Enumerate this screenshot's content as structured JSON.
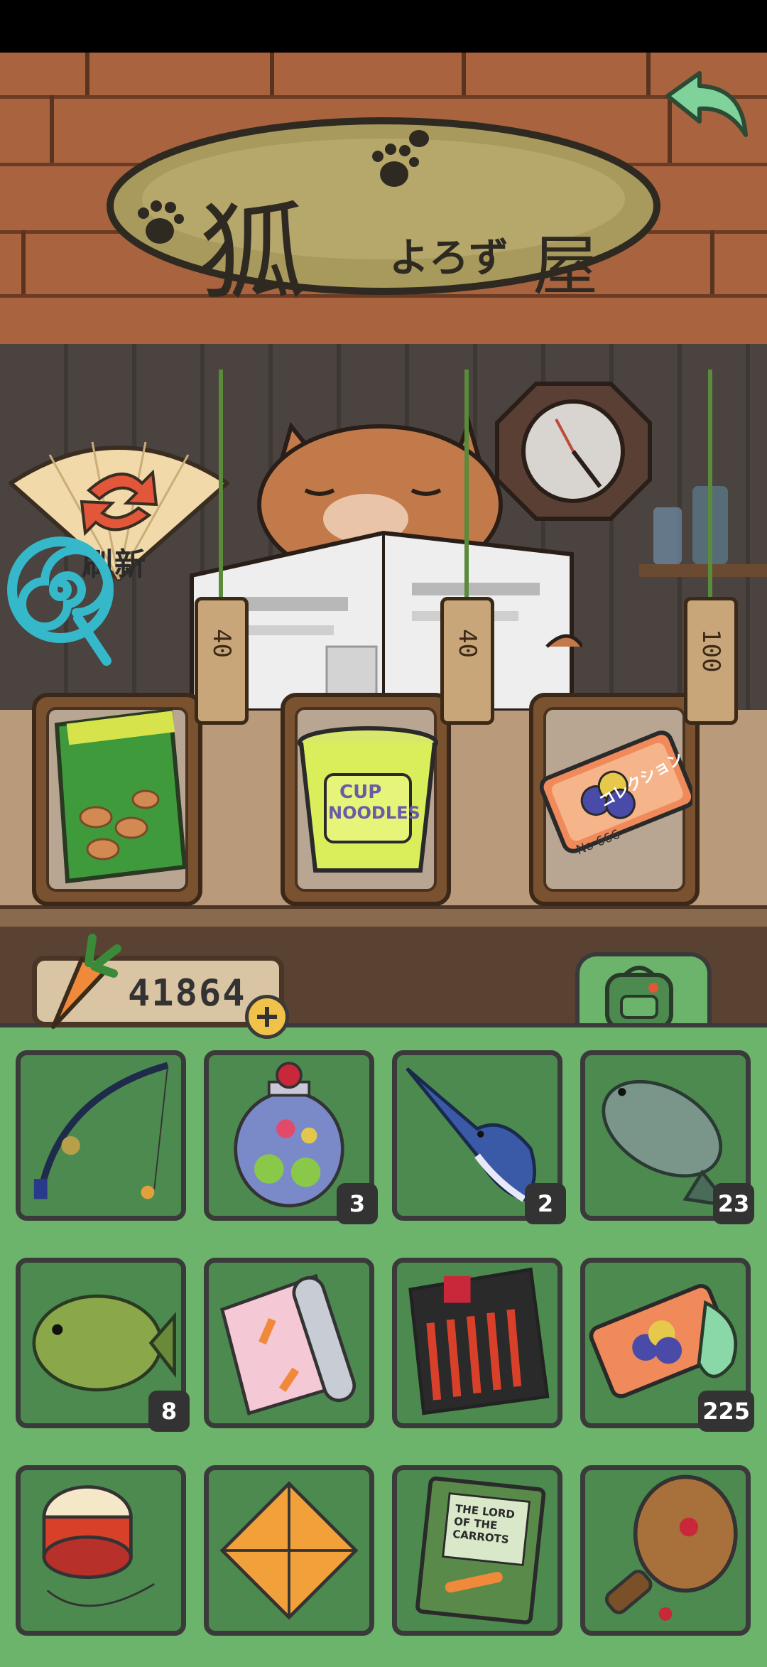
{
  "shop": {
    "sign": {
      "kanji": "狐",
      "kana": "よろず",
      "ya": "屋"
    },
    "refresh_label": "刷新",
    "shelf": [
      {
        "item": "carrot-snack-bag-icon",
        "price": "40"
      },
      {
        "item": "cup-noodles-icon",
        "price": "40",
        "cup_text1": "CUP",
        "cup_text2": "NOODLES"
      },
      {
        "item": "collection-ticket-icon",
        "price": "100",
        "ticket_text": "コレクション",
        "ticket_no": "No 666"
      }
    ]
  },
  "currency": {
    "value": "41864"
  },
  "inventory": [
    {
      "name": "fishing-rod-icon",
      "count": ""
    },
    {
      "name": "candy-jar-icon",
      "count": "3"
    },
    {
      "name": "swordfish-icon",
      "count": "2"
    },
    {
      "name": "fish-icon",
      "count": "23"
    },
    {
      "name": "bluegill-fish-icon",
      "count": "8"
    },
    {
      "name": "cloth-roll-icon",
      "count": ""
    },
    {
      "name": "spicy-strips-icon",
      "count": ""
    },
    {
      "name": "collection-ticket-icon",
      "count": "225"
    },
    {
      "name": "yoyo-icon",
      "count": ""
    },
    {
      "name": "fortune-teller-icon",
      "count": ""
    },
    {
      "name": "book-icon",
      "count": "",
      "book_title": "THE LORD OF THE CARROTS"
    },
    {
      "name": "paddle-ball-icon",
      "count": ""
    }
  ],
  "colors": {
    "panel": "#6cb36b",
    "cell": "#4c8a4f",
    "wood": "#a9643f"
  }
}
